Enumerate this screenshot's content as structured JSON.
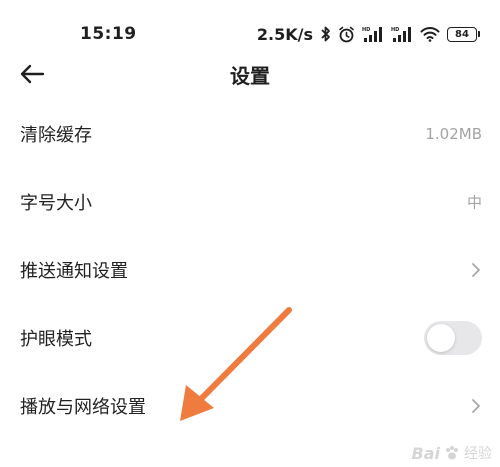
{
  "status_bar": {
    "time": "15:19",
    "net_speed": "2.5K/s",
    "battery": "84",
    "icons": [
      "bluetooth-icon",
      "alarm-icon",
      "signal-icon",
      "signal-icon",
      "wifi-icon",
      "battery-icon"
    ]
  },
  "header": {
    "back_icon": "arrow-left-icon",
    "title": "设置"
  },
  "settings": {
    "items": [
      {
        "label": "清除缓存",
        "value": "1.02MB"
      },
      {
        "label": "字号大小",
        "value": "中"
      },
      {
        "label": "推送通知设置"
      },
      {
        "label": "护眼模式",
        "toggle_on": false
      },
      {
        "label": "播放与网络设置"
      }
    ]
  },
  "annotation": {
    "arrow_color": "#f07b3f"
  },
  "watermark": {
    "text": "Bai",
    "sub": "经验"
  }
}
